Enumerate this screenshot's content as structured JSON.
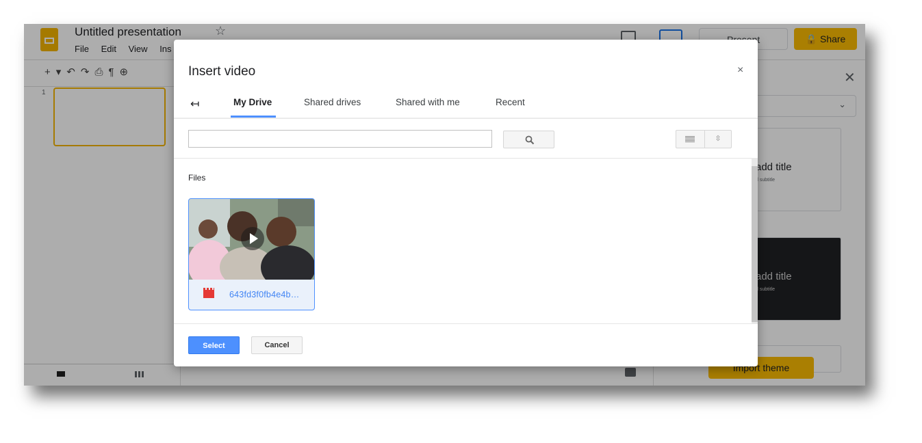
{
  "app": {
    "doc_title": "Untitled presentation",
    "menu": [
      "File",
      "Edit",
      "View",
      "Ins"
    ],
    "toolbar_icons": [
      "add-icon",
      "undo-icon",
      "redo-icon",
      "print-icon",
      "paint-format-icon",
      "zoom-icon"
    ],
    "present_label": "Present",
    "share_label": "Share",
    "slide_number": "1",
    "themes": {
      "card_title": "add title",
      "card_subtitle": "d subtitle",
      "import_label": "Import theme"
    }
  },
  "dialog": {
    "title": "Insert video",
    "close_glyph": "×",
    "back_glyph": "↤",
    "tabs": [
      {
        "label": "My Drive",
        "active": true
      },
      {
        "label": "Shared drives",
        "active": false
      },
      {
        "label": "Shared with me",
        "active": false
      },
      {
        "label": "Recent",
        "active": false
      }
    ],
    "search": {
      "value": "",
      "placeholder": ""
    },
    "section_label": "Files",
    "file": {
      "name": "643fd3f0fb4e4b…",
      "type_icon": "video-file-icon",
      "selected": true
    },
    "select_label": "Select",
    "cancel_label": "Cancel"
  },
  "colors": {
    "accent_blue": "#4d90fe",
    "share_yellow": "#fbbc04",
    "file_link": "#4285f4"
  }
}
